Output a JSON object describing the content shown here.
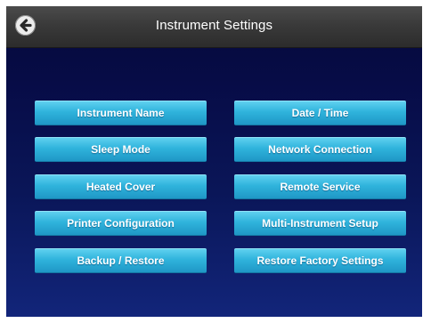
{
  "header": {
    "title": "Instrument Settings",
    "back_icon": "arrow-left-circle-icon"
  },
  "buttons": {
    "left": [
      "Instrument Name",
      "Sleep Mode",
      "Heated Cover",
      "Printer Configuration",
      "Backup / Restore"
    ],
    "right": [
      "Date / Time",
      "Network Connection",
      "Remote Service",
      "Multi-Instrument Setup",
      "Restore Factory Settings"
    ]
  },
  "colors": {
    "background": "#0a1658",
    "titlebar": "#3a3a3a",
    "button": "#2fb3dc",
    "button_text": "#ffffff"
  }
}
